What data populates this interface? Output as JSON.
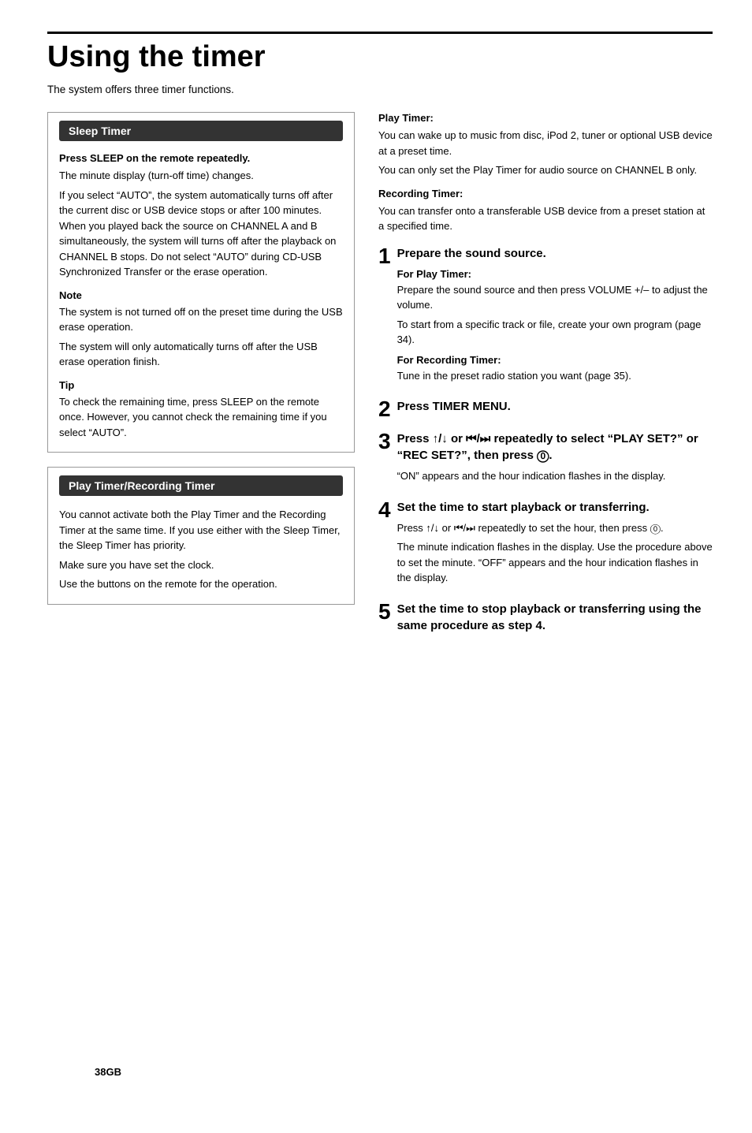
{
  "page": {
    "title": "Using the timer",
    "intro": "The system offers three timer functions.",
    "page_number": "38GB"
  },
  "sleep_timer": {
    "heading": "Sleep Timer",
    "subsections": [
      {
        "title": "Press SLEEP on the remote repeatedly.",
        "paragraphs": [
          "The minute display (turn-off time) changes.",
          "If you select “AUTO”, the system automatically turns off after the current disc or USB device stops or after 100 minutes. When you played back the source on CHANNEL A and B simultaneously, the system will turns off after the playback on CHANNEL B stops. Do not select “AUTO” during CD-USB Synchronized Transfer or the erase operation."
        ]
      }
    ],
    "note_title": "Note",
    "note_paragraphs": [
      "The system is not turned off on the preset time during the USB erase operation.",
      "The system will only automatically turns off after the USB erase operation finish."
    ],
    "tip_title": "Tip",
    "tip_paragraph": "To check the remaining time, press SLEEP on the remote once. However, you cannot check the remaining time if you select “AUTO”."
  },
  "play_timer": {
    "heading": "Play Timer/Recording Timer",
    "intro_paragraphs": [
      "You cannot activate both the Play Timer and the Recording Timer at the same time. If you use either with the Sleep Timer, the Sleep Timer has priority.",
      "Make sure you have set the clock.",
      "Use the buttons on the remote for the operation."
    ],
    "play_timer_title": "Play Timer:",
    "play_timer_paragraphs": [
      "You can wake up to music from disc, iPod 2, tuner or optional USB device at a preset time.",
      "You can only set the Play Timer for audio source on CHANNEL B only."
    ],
    "recording_timer_title": "Recording Timer:",
    "recording_timer_paragraph": "You can transfer onto a transferable USB device from a preset station at a specified time."
  },
  "steps": [
    {
      "number": "1",
      "heading": "Prepare the sound source.",
      "substeps": [
        {
          "title": "For Play Timer:",
          "text": "Prepare the sound source and then press VOLUME +/– to adjust the volume.\nTo start from a specific track or file, create your own program (page 34)."
        },
        {
          "title": "For Recording Timer:",
          "text": "Tune in the preset radio station you want (page 35)."
        }
      ]
    },
    {
      "number": "2",
      "heading": "Press TIMER MENU.",
      "substeps": []
    },
    {
      "number": "3",
      "heading": "Press ↑/↓ or ⏮/⏭ repeatedly to select “PLAY SET?” or “REC SET?”, then press ⓪.",
      "substeps": [
        {
          "title": "",
          "text": "“ON” appears and the hour indication flashes in the display."
        }
      ]
    },
    {
      "number": "4",
      "heading": "Set the time to start playback or transferring.",
      "substeps": [
        {
          "title": "",
          "text": "Press ↑/↓ or ⏮/⏭ repeatedly to set the hour, then press ⓪.\nThe minute indication flashes in the display. Use the procedure above to set the minute. “OFF” appears and the hour indication flashes in the display."
        }
      ]
    },
    {
      "number": "5",
      "heading": "Set the time to stop playback or transferring using the same procedure as step 4.",
      "substeps": []
    }
  ]
}
